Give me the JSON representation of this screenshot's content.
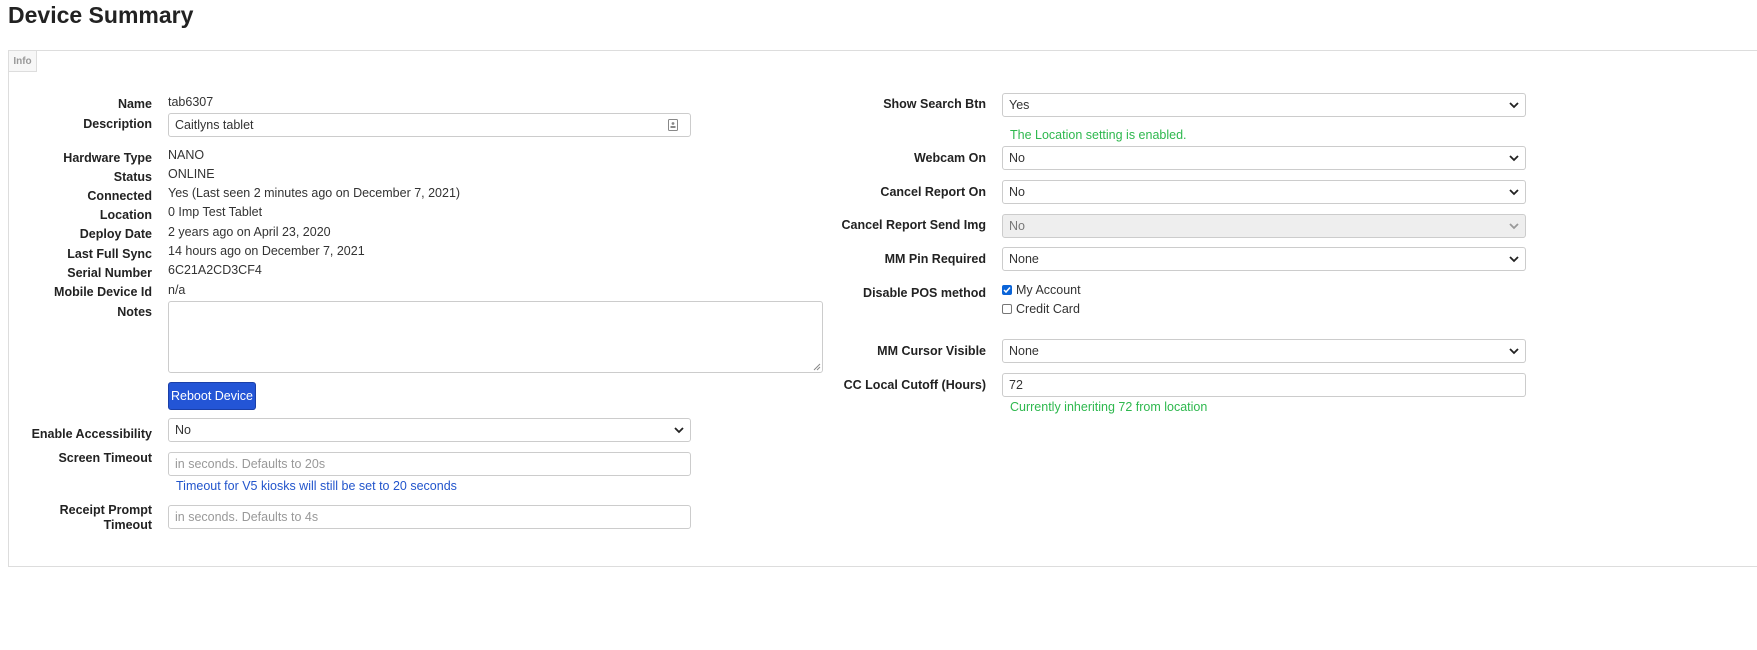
{
  "page": {
    "title": "Device Summary"
  },
  "tabs": [
    {
      "label": "Info"
    }
  ],
  "left": {
    "name": {
      "label": "Name",
      "value": "tab6307"
    },
    "description": {
      "label": "Description",
      "value": "Caitlyns tablet"
    },
    "hardware_type": {
      "label": "Hardware Type",
      "value": "NANO"
    },
    "status": {
      "label": "Status",
      "value": "ONLINE"
    },
    "connected": {
      "label": "Connected",
      "value": "Yes (Last seen 2 minutes ago on December 7, 2021)"
    },
    "location": {
      "label": "Location",
      "value": "0 Imp Test Tablet"
    },
    "deploy_date": {
      "label": "Deploy Date",
      "value": "2 years ago on April 23, 2020"
    },
    "last_full_sync": {
      "label": "Last Full Sync",
      "value": "14 hours ago on December 7, 2021"
    },
    "serial_number": {
      "label": "Serial Number",
      "value": "6C21A2CD3CF4"
    },
    "mobile_device_id": {
      "label": "Mobile Device Id",
      "value": "n/a"
    },
    "notes": {
      "label": "Notes",
      "value": ""
    },
    "reboot_button": {
      "label": "Reboot Device"
    },
    "enable_accessibility": {
      "label": "Enable Accessibility",
      "value": "No"
    },
    "screen_timeout": {
      "label": "Screen Timeout",
      "value": "",
      "placeholder": "in seconds. Defaults to 20s",
      "hint": "Timeout for V5 kiosks will still be set to 20 seconds"
    },
    "receipt_prompt_timeout": {
      "label": "Receipt Prompt Timeout",
      "value": "",
      "placeholder": "in seconds. Defaults to 4s"
    }
  },
  "right": {
    "show_search_btn": {
      "label": "Show Search Btn",
      "value": "Yes",
      "hint": "The Location setting is enabled."
    },
    "webcam_on": {
      "label": "Webcam On",
      "value": "No"
    },
    "cancel_report_on": {
      "label": "Cancel Report On",
      "value": "No"
    },
    "cancel_report_send_img": {
      "label": "Cancel Report Send Img",
      "value": "No"
    },
    "mm_pin_required": {
      "label": "MM Pin Required",
      "value": "None"
    },
    "disable_pos_method": {
      "label": "Disable POS method",
      "options": [
        {
          "label": "My Account",
          "checked": true
        },
        {
          "label": "Credit Card",
          "checked": false
        }
      ]
    },
    "mm_cursor_visible": {
      "label": "MM Cursor Visible",
      "value": "None"
    },
    "cc_local_cutoff": {
      "label": "CC Local Cutoff (Hours)",
      "value": "72",
      "hint": "Currently inheriting 72 from location"
    }
  },
  "colors": {
    "primary_button": "#2355d6",
    "hint_green": "#2eb84e",
    "hint_blue": "#2255cc",
    "checkbox": "#0a64d8"
  }
}
